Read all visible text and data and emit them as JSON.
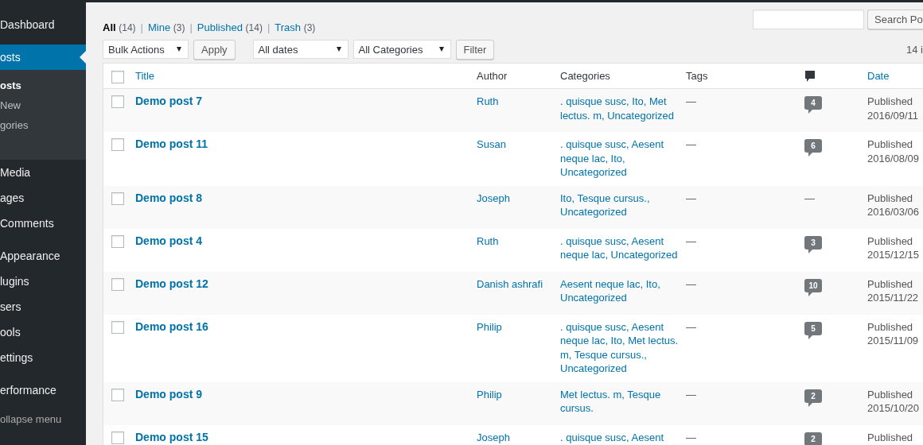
{
  "sidebar": {
    "groups": [
      [
        {
          "label": "Dashboard",
          "selected": false
        }
      ],
      [
        {
          "label": "osts",
          "selected": true,
          "children": [
            {
              "label": "osts",
              "selected": true
            },
            {
              "label": "New",
              "selected": false
            },
            {
              "label": "gories",
              "selected": false
            }
          ]
        },
        {
          "label": "Media",
          "selected": false
        },
        {
          "label": "ages",
          "selected": false
        },
        {
          "label": "Comments",
          "selected": false
        }
      ],
      [
        {
          "label": "Appearance",
          "selected": false
        },
        {
          "label": "lugins",
          "selected": false
        },
        {
          "label": "sers",
          "selected": false
        },
        {
          "label": "ools",
          "selected": false
        },
        {
          "label": "ettings",
          "selected": false
        }
      ],
      [
        {
          "label": "erformance",
          "selected": false
        }
      ]
    ],
    "collapse": "ollapse menu"
  },
  "views": [
    {
      "label": "All",
      "count": "(14)",
      "selected": true
    },
    {
      "separator": "|",
      "label": "Mine",
      "count": "(3)",
      "selected": false
    },
    {
      "separator": "|",
      "label": "Published",
      "count": "(14)",
      "selected": false
    },
    {
      "separator": "|",
      "label": "Trash",
      "count": "(3)",
      "selected": false
    }
  ],
  "search": {
    "button": "Search Po"
  },
  "toolbar": {
    "bulk_actions": "Bulk Actions",
    "apply": "Apply",
    "dates": "All dates",
    "categories": "All Categories",
    "filter": "Filter",
    "items_count": "14 i"
  },
  "table": {
    "columns": [
      {
        "kind": "checkbox",
        "checked": false
      },
      {
        "kind": "sortable",
        "label": "Title"
      },
      {
        "kind": "text",
        "label": "Author"
      },
      {
        "kind": "text",
        "label": "Categories"
      },
      {
        "kind": "text",
        "label": "Tags"
      },
      {
        "kind": "comments"
      },
      {
        "kind": "sortable",
        "label": "Date"
      }
    ],
    "rows": [
      {
        "checked": false,
        "title": "Demo post 7",
        "author": "Ruth",
        "categories": ". quisque susc, Ito, Met lectus. m, Uncategorized",
        "tags": "—",
        "comments": {
          "kind": "bubble",
          "text": "4"
        },
        "status": "Published",
        "date": "2016/09/11"
      },
      {
        "checked": false,
        "title": "Demo post 11",
        "author": "Susan",
        "categories": ". quisque susc, Aesent neque lac, Ito, Uncategorized",
        "tags": "—",
        "comments": {
          "kind": "bubble",
          "text": "6"
        },
        "status": "Published",
        "date": "2016/08/09"
      },
      {
        "checked": false,
        "title": "Demo post 8",
        "author": "Joseph",
        "categories": "Ito, Tesque cursus., Uncategorized",
        "tags": "—",
        "comments": {
          "kind": "none",
          "text": "—"
        },
        "status": "Published",
        "date": "2016/03/06"
      },
      {
        "checked": false,
        "title": "Demo post 4",
        "author": "Ruth",
        "categories": ". quisque susc, Aesent neque lac, Uncategorized",
        "tags": "—",
        "comments": {
          "kind": "bubble",
          "text": "3"
        },
        "status": "Published",
        "date": "2015/12/15"
      },
      {
        "checked": false,
        "title": "Demo post 12",
        "author": "Danish ashrafi",
        "categories": "Aesent neque lac, Ito, Uncategorized",
        "tags": "—",
        "comments": {
          "kind": "bubble",
          "text": "10"
        },
        "status": "Published",
        "date": "2015/11/22"
      },
      {
        "checked": false,
        "title": "Demo post 16",
        "author": "Philip",
        "categories": ". quisque susc, Aesent neque lac, Ito, Met lectus. m, Tesque cursus., Uncategorized",
        "tags": "—",
        "comments": {
          "kind": "bubble",
          "text": "5"
        },
        "status": "Published",
        "date": "2015/11/09"
      },
      {
        "checked": false,
        "title": "Demo post 9",
        "author": "Philip",
        "categories": "Met lectus. m, Tesque cursus.",
        "tags": "—",
        "comments": {
          "kind": "bubble",
          "text": "2"
        },
        "status": "Published",
        "date": "2015/10/20"
      },
      {
        "checked": false,
        "title": "Demo post 15",
        "author": "Joseph",
        "categories": ". quisque susc, Aesent",
        "tags": "—",
        "comments": {
          "kind": "bubble",
          "text": "2"
        },
        "status": "Published"
      }
    ]
  }
}
